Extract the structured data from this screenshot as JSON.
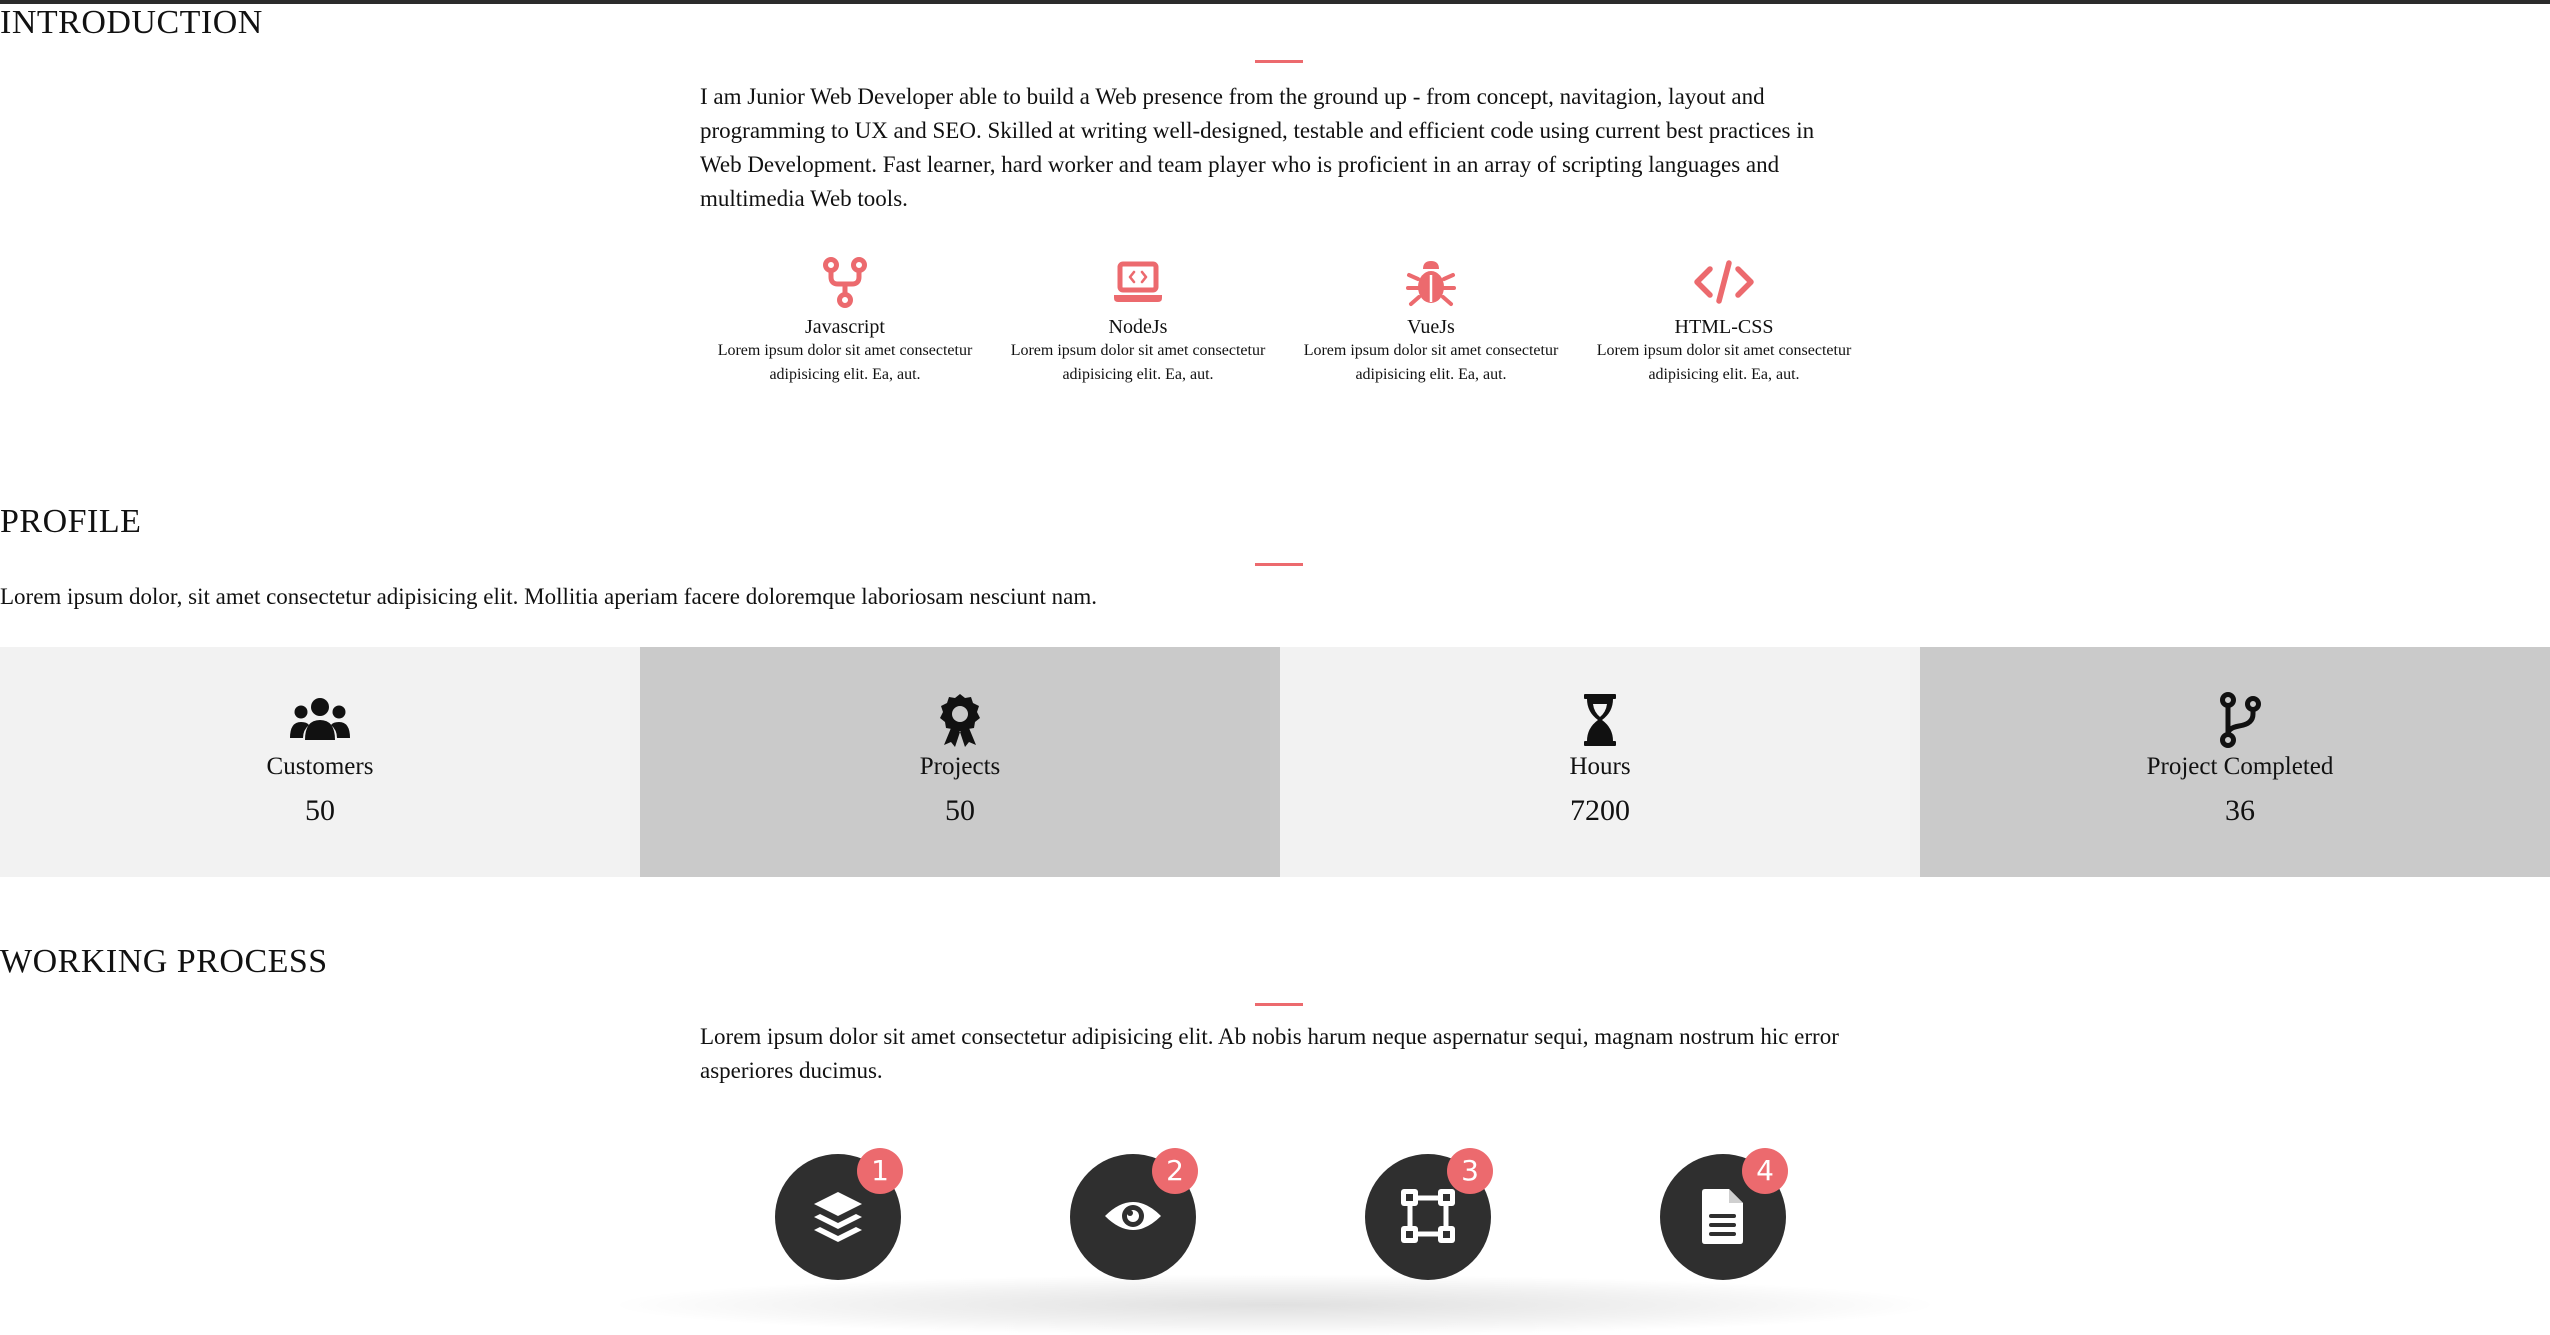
{
  "colors": {
    "accent": "#ec6a6e",
    "stat_light_bg": "#f2f2f2",
    "stat_dark_bg": "#cacaca",
    "process_circle": "#2f2f2f"
  },
  "introduction": {
    "title": "INTRODUCTION",
    "text": "I am Junior Web Developer able to build a Web presence from the ground up - from concept, navitagion, layout and programming to UX and SEO. Skilled at writing well-designed, testable and efficient code using current best practices in Web Development. Fast learner, hard worker and team player who is proficient in an array of scripting languages and multimedia Web tools.",
    "skills": [
      {
        "icon": "fork-icon",
        "name": "Javascript",
        "desc": "Lorem ipsum dolor sit amet consectetur adipisicing elit. Ea, aut."
      },
      {
        "icon": "laptop-code-icon",
        "name": "NodeJs",
        "desc": "Lorem ipsum dolor sit amet consectetur adipisicing elit. Ea, aut."
      },
      {
        "icon": "bug-icon",
        "name": "VueJs",
        "desc": "Lorem ipsum dolor sit amet consectetur adipisicing elit. Ea, aut."
      },
      {
        "icon": "code-icon",
        "name": "HTML-CSS",
        "desc": "Lorem ipsum dolor sit amet consectetur adipisicing elit. Ea, aut."
      }
    ]
  },
  "profile": {
    "title": "PROFILE",
    "text": "Lorem ipsum dolor, sit amet consectetur adipisicing elit. Mollitia aperiam facere doloremque laboriosam nesciunt nam.",
    "stats": [
      {
        "icon": "users-icon",
        "label": "Customers",
        "value": "50"
      },
      {
        "icon": "award-icon",
        "label": "Projects",
        "value": "50"
      },
      {
        "icon": "hourglass-icon",
        "label": "Hours",
        "value": "7200"
      },
      {
        "icon": "code-branch-icon",
        "label": "Project Completed",
        "value": "36"
      }
    ]
  },
  "working_process": {
    "title": "WORKING PROCESS",
    "text": "Lorem ipsum dolor sit amet consectetur adipisicing elit. Ab nobis harum neque aspernatur sequi, magnam nostrum hic error asperiores ducimus.",
    "steps": [
      {
        "icon": "layers-icon",
        "number": "1"
      },
      {
        "icon": "eye-icon",
        "number": "2"
      },
      {
        "icon": "vector-square-icon",
        "number": "3"
      },
      {
        "icon": "file-icon",
        "number": "4"
      }
    ]
  }
}
